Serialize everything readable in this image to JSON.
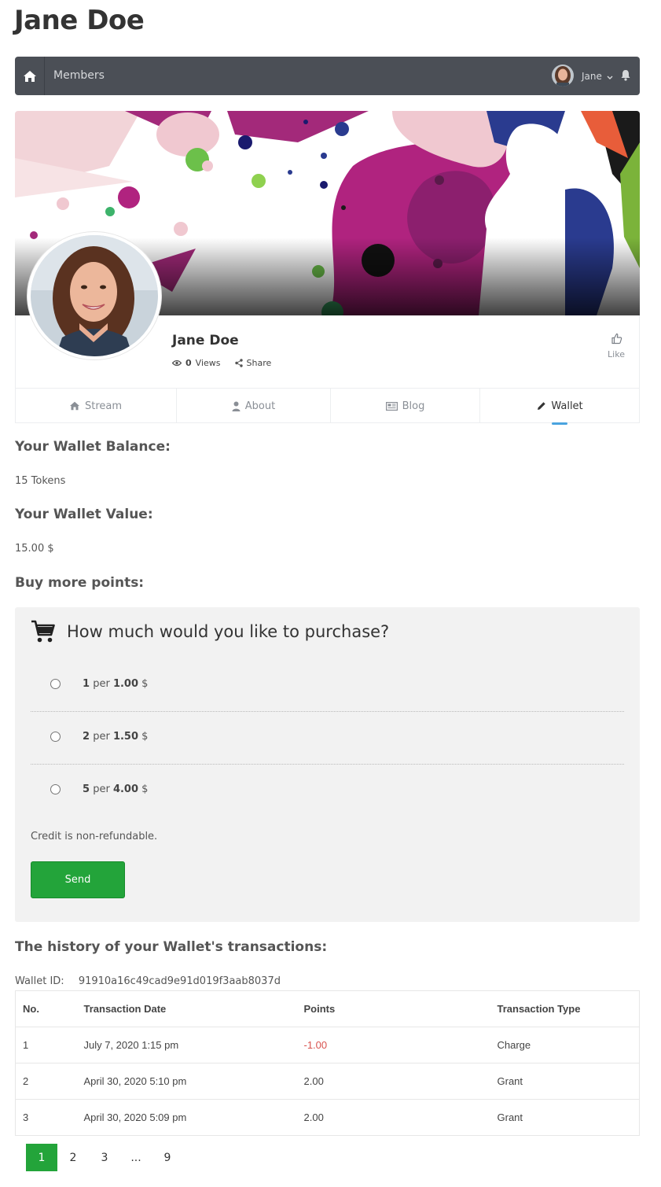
{
  "page": {
    "title": "Jane Doe"
  },
  "navbar": {
    "home_icon": "home-icon",
    "members_label": "Members",
    "user_name": "Jane",
    "bell_icon": "bell-icon",
    "bg_color": "#4b4f56"
  },
  "profile": {
    "name": "Jane Doe",
    "views_count": "0",
    "views_label": "Views",
    "share_label": "Share",
    "like_label": "Like"
  },
  "tabs": [
    {
      "label": "Stream",
      "icon": "home-icon"
    },
    {
      "label": "About",
      "icon": "user-icon"
    },
    {
      "label": "Blog",
      "icon": "newspaper-icon"
    },
    {
      "label": "Wallet",
      "icon": "pencil-icon",
      "active": true
    }
  ],
  "wallet": {
    "balance_heading": "Your Wallet Balance:",
    "balance_value": "15 Tokens",
    "value_heading": "Your Wallet Value:",
    "value_value": "15.00 $",
    "buy_heading": "Buy more points:"
  },
  "purchase": {
    "title": "How much would you like to purchase?",
    "options": [
      {
        "qty": "1",
        "per": "per",
        "price": "1.00",
        "currency": "$"
      },
      {
        "qty": "2",
        "per": "per",
        "price": "1.50",
        "currency": "$"
      },
      {
        "qty": "5",
        "per": "per",
        "price": "4.00",
        "currency": "$"
      }
    ],
    "note": "Credit is non-refundable.",
    "send_label": "Send",
    "accent": "#23a43a"
  },
  "history": {
    "heading": "The history of your Wallet's transactions:",
    "wallet_id_label": "Wallet ID:",
    "wallet_id_value": "91910a16c49cad9e91d019f3aab8037d",
    "columns": [
      "No.",
      "Transaction Date",
      "Points",
      "Transaction Type"
    ],
    "rows": [
      {
        "no": "1",
        "date": "July 7, 2020 1:15 pm",
        "points": "-1.00",
        "type": "Charge"
      },
      {
        "no": "2",
        "date": "April 30, 2020 5:10 pm",
        "points": "2.00",
        "type": "Grant"
      },
      {
        "no": "3",
        "date": "April 30, 2020 5:09 pm",
        "points": "2.00",
        "type": "Grant"
      }
    ]
  },
  "pagination": {
    "pages": [
      "1",
      "2",
      "3",
      "...",
      "9"
    ],
    "current": "1"
  }
}
